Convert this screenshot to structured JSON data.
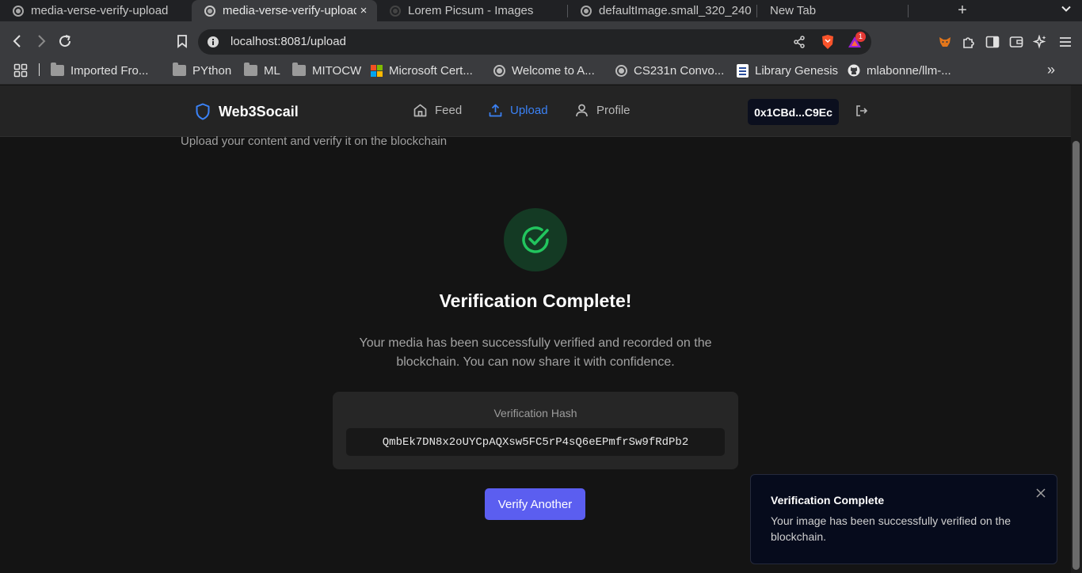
{
  "browser": {
    "tabs": [
      {
        "title": "media-verse-verify-upload",
        "active": false
      },
      {
        "title": "media-verse-verify-upload",
        "active": true
      },
      {
        "title": "Lorem Picsum - Images",
        "active": false
      },
      {
        "title": "defaultImage.small_320_240",
        "active": false
      },
      {
        "title": "New Tab",
        "active": false
      }
    ],
    "new_tab_symbol": "+",
    "tab_close_symbol": "×",
    "address": {
      "host": "localhost",
      "path": ":8081/upload"
    },
    "brave_badge_count": "1",
    "bookmarks": [
      {
        "label": "Imported Fro...",
        "icon": "folder-icon"
      },
      {
        "label": "PYthon",
        "icon": "folder-icon"
      },
      {
        "label": "ML",
        "icon": "folder-icon"
      },
      {
        "label": "MITOCW",
        "icon": "folder-icon"
      },
      {
        "label": "Microsoft Cert...",
        "icon": "microsoft-icon"
      },
      {
        "label": "Welcome to A...",
        "icon": "globe-icon"
      },
      {
        "label": "CS231n Convo...",
        "icon": "globe-icon"
      },
      {
        "label": "Library Genesis",
        "icon": "book-icon"
      },
      {
        "label": "mlabonne/llm-...",
        "icon": "github-icon"
      }
    ],
    "bookmarks_overflow": "»"
  },
  "app": {
    "brand": "Web3Socail",
    "nav": {
      "feed": "Feed",
      "upload": "Upload",
      "profile": "Profile"
    },
    "wallet_address": "0x1CBd...C9Ec",
    "subtitle": "Upload your content and verify it on the blockchain",
    "result": {
      "title": "Verification Complete!",
      "description": "Your media has been successfully verified and recorded on the blockchain. You can now share it with confidence.",
      "hash_label": "Verification Hash",
      "hash_value": "QmbEk7DN8x2oUYCpAQXsw5FC5rP4sQ6eEPmfrSw9fRdPb2",
      "button_label": "Verify Another"
    },
    "toast": {
      "title": "Verification Complete",
      "message": "Your image has been successfully verified on the blockchain."
    }
  },
  "colors": {
    "accent_blue": "#3b82f6",
    "success_green": "#22c55e",
    "button_indigo": "#5b5ef0",
    "wallet_bg": "#0b0f1e"
  }
}
